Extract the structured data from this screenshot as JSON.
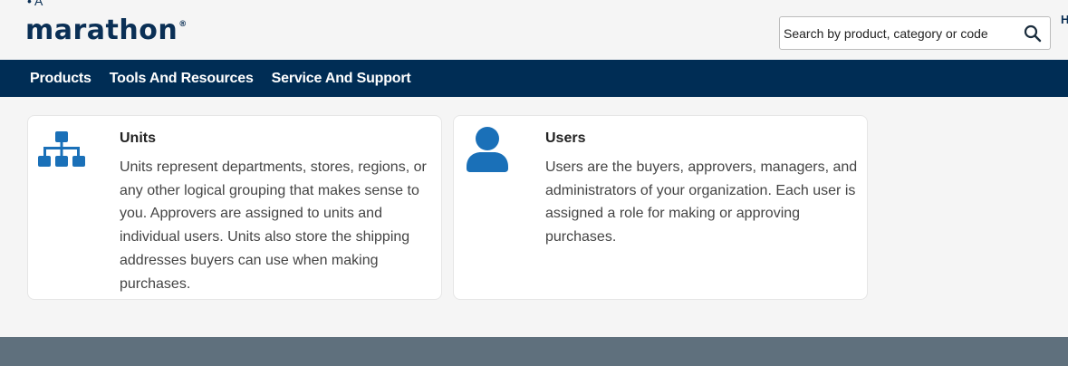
{
  "header": {
    "top_glyph": "• A",
    "logo_text": "marathon",
    "logo_mark": "®",
    "search": {
      "placeholder": "Search by product, category or code",
      "value": ""
    },
    "edge_text": "H"
  },
  "nav": {
    "items": [
      {
        "label": "Products"
      },
      {
        "label": "Tools And Resources"
      },
      {
        "label": "Service And Support"
      }
    ]
  },
  "cards": [
    {
      "title": "Units",
      "icon": "org-chart-icon",
      "description": "Units represent departments, stores, regions, or any other logical grouping that makes sense to you. Approvers are assigned to units and individual users. Units also store the shipping addresses buyers can use when making purchases."
    },
    {
      "title": "Users",
      "icon": "user-icon",
      "description": "Users are the buyers, approvers, managers, and administrators of your organization. Each user is assigned a role for making or approving purchases."
    }
  ],
  "colors": {
    "brand": "#0a2f55",
    "nav_bg": "#002d55",
    "icon_blue": "#1a70b8",
    "footer_bg": "#5f707d",
    "page_bg": "#f5f5f5"
  }
}
